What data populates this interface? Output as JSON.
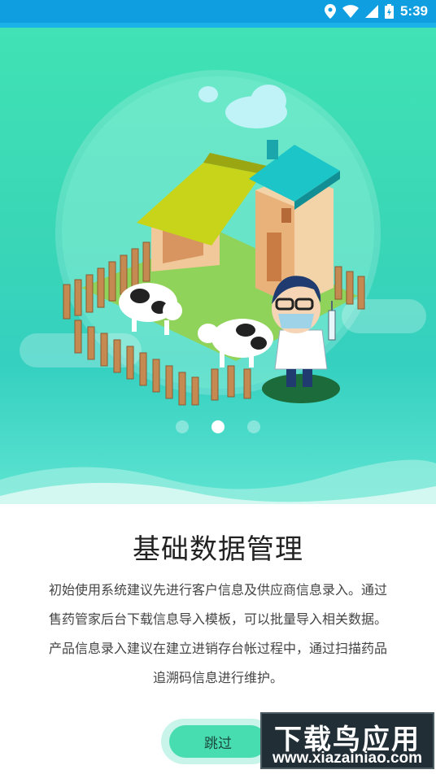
{
  "status_bar": {
    "time": "5:39",
    "icons": [
      "location-icon",
      "wifi-icon",
      "signal-icon",
      "battery-icon"
    ]
  },
  "carousel": {
    "page_count": 3,
    "active_page": 2
  },
  "page": {
    "title": "基础数据管理",
    "description": "初始使用系统建议先进行客户信息及供应商信息录入。通过售药管家后台下载信息导入模板，可以批量导入相关数据。产品信息录入建议在建立进销存台帐过程中，通过扫描药品追溯码信息进行维护。"
  },
  "skip_button": {
    "label": "跳过"
  },
  "watermark": {
    "brand": "下载鸟应用",
    "url": "www.xiazainiao.com"
  },
  "colors": {
    "status_bar": "#0f9fe0",
    "hero_top": "#41e2b5",
    "hero_bottom": "#5fe4d2",
    "accent_green": "#48dcb1"
  },
  "illustration": {
    "icon": "farm-vet-illustration"
  }
}
